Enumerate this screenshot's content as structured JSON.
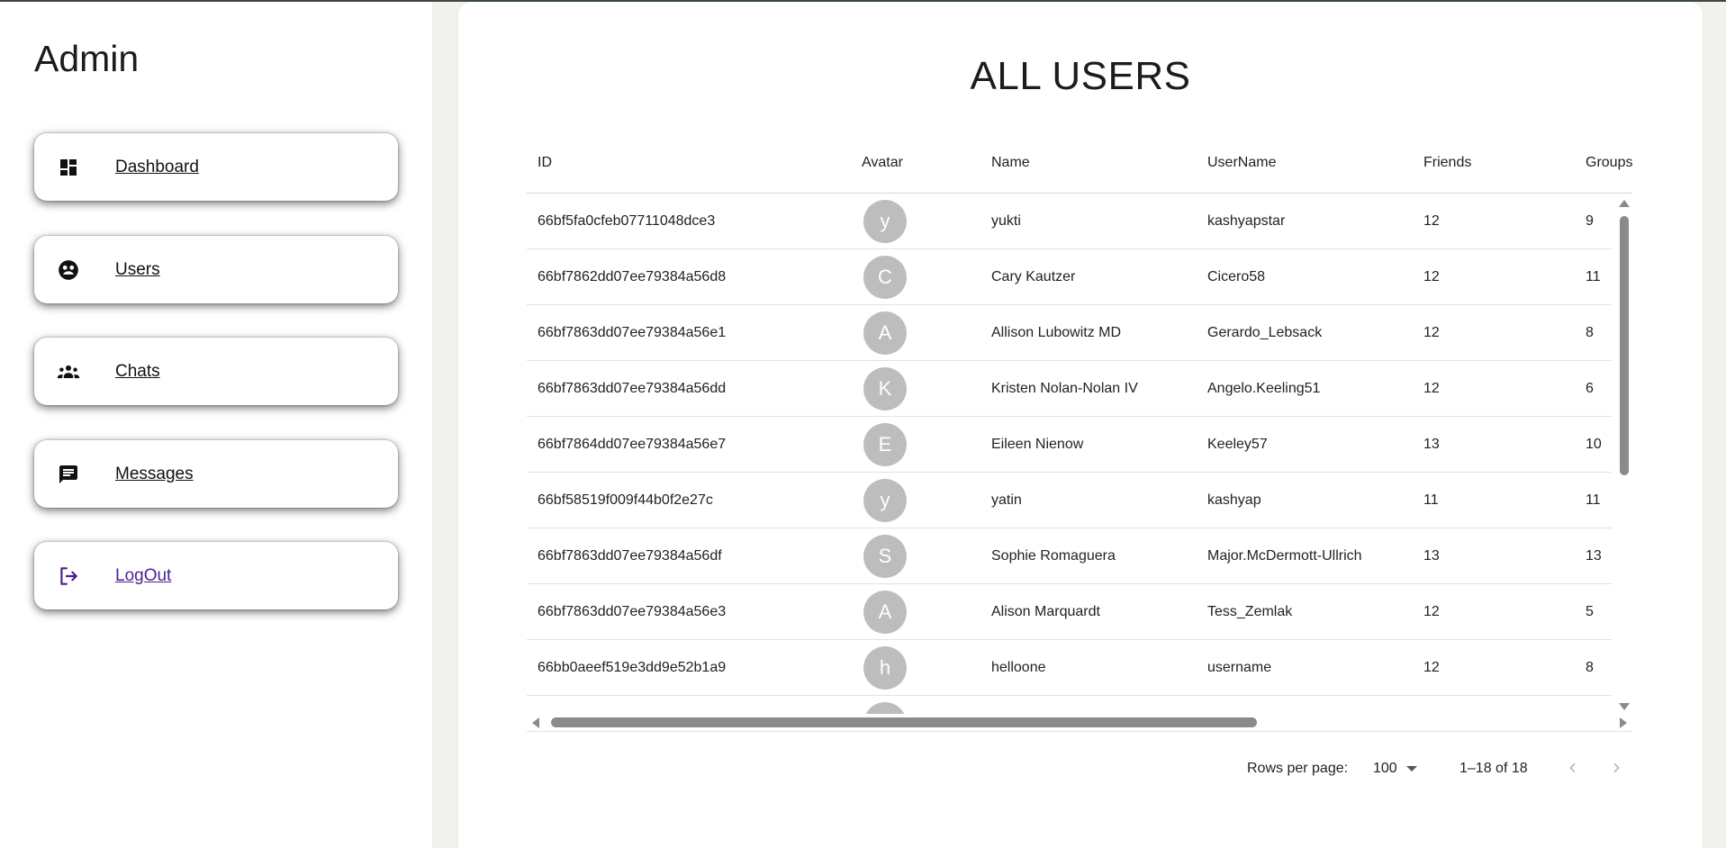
{
  "sidebar": {
    "title": "Admin",
    "items": [
      {
        "label": "Dashboard",
        "icon": "dashboard-icon"
      },
      {
        "label": "Users",
        "icon": "users-face-icon"
      },
      {
        "label": "Chats",
        "icon": "groups-icon"
      },
      {
        "label": "Messages",
        "icon": "message-icon"
      },
      {
        "label": "LogOut",
        "icon": "logout-icon"
      }
    ]
  },
  "main": {
    "title": "ALL USERS",
    "columns": [
      "ID",
      "Avatar",
      "Name",
      "UserName",
      "Friends",
      "Groups"
    ],
    "rows": [
      {
        "id": "66bf5fa0cfeb07711048dce3",
        "avatar": "y",
        "name": "yukti",
        "username": "kashyapstar",
        "friends": "12",
        "groups": "9"
      },
      {
        "id": "66bf7862dd07ee79384a56d8",
        "avatar": "C",
        "name": "Cary Kautzer",
        "username": "Cicero58",
        "friends": "12",
        "groups": "11"
      },
      {
        "id": "66bf7863dd07ee79384a56e1",
        "avatar": "A",
        "name": "Allison Lubowitz MD",
        "username": "Gerardo_Lebsack",
        "friends": "12",
        "groups": "8"
      },
      {
        "id": "66bf7863dd07ee79384a56dd",
        "avatar": "K",
        "name": "Kristen Nolan-Nolan IV",
        "username": "Angelo.Keeling51",
        "friends": "12",
        "groups": "6"
      },
      {
        "id": "66bf7864dd07ee79384a56e7",
        "avatar": "E",
        "name": "Eileen Nienow",
        "username": "Keeley57",
        "friends": "13",
        "groups": "10"
      },
      {
        "id": "66bf58519f009f44b0f2e27c",
        "avatar": "y",
        "name": "yatin",
        "username": "kashyap",
        "friends": "11",
        "groups": "11"
      },
      {
        "id": "66bf7863dd07ee79384a56df",
        "avatar": "S",
        "name": "Sophie Romaguera",
        "username": "Major.McDermott-Ullrich",
        "friends": "13",
        "groups": "13"
      },
      {
        "id": "66bf7863dd07ee79384a56e3",
        "avatar": "A",
        "name": "Alison Marquardt",
        "username": "Tess_Zemlak",
        "friends": "12",
        "groups": "5"
      },
      {
        "id": "66bb0aeef519e3dd9e52b1a9",
        "avatar": "h",
        "name": "helloone",
        "username": "username",
        "friends": "12",
        "groups": "8"
      }
    ],
    "pagination": {
      "rows_per_page_label": "Rows per page:",
      "rows_per_page": "100",
      "range": "1–18 of 18"
    }
  },
  "colors": {
    "background": "#f1f1ee",
    "avatar": "#bdbdbd",
    "logout_accent": "#4b1f8f"
  }
}
